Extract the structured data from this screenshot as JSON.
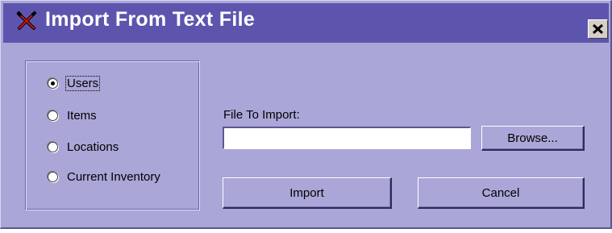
{
  "window": {
    "title": "Import From Text File",
    "title_bar_color": "#5d55ad",
    "body_color": "#aaa6d8",
    "app_icon": "crossed-tools-icon",
    "close_icon": "close-x-icon"
  },
  "import_type": {
    "options": [
      {
        "label": "Users",
        "checked": true,
        "focused": true
      },
      {
        "label": "Items",
        "checked": false,
        "focused": false
      },
      {
        "label": "Locations",
        "checked": false,
        "focused": false
      },
      {
        "label": "Current Inventory",
        "checked": false,
        "focused": false
      }
    ]
  },
  "file": {
    "label": "File To Import:",
    "value": "",
    "browse_label": "Browse..."
  },
  "actions": {
    "import_label": "Import",
    "cancel_label": "Cancel"
  }
}
